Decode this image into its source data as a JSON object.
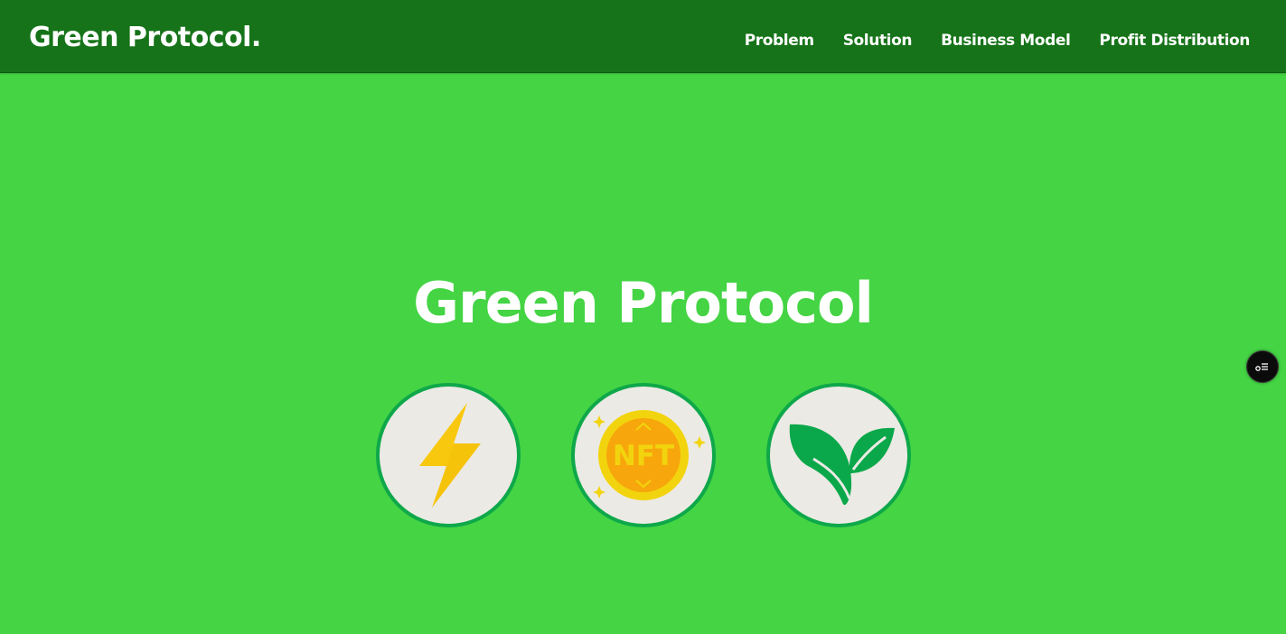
{
  "header": {
    "brand": "Green Protocol.",
    "nav": [
      {
        "label": "Problem"
      },
      {
        "label": "Solution"
      },
      {
        "label": "Business Model"
      },
      {
        "label": "Profit Distribution"
      }
    ]
  },
  "hero": {
    "title": "Green Protocol",
    "icons": [
      {
        "name": "lightning-icon"
      },
      {
        "name": "nft-coin-icon",
        "text": "NFT"
      },
      {
        "name": "leaf-icon"
      }
    ]
  },
  "floating_button": {
    "icon": "options-toggle-icon"
  },
  "colors": {
    "background": "#44d444",
    "navbar": "#167319",
    "circle_border": "#0ea84a",
    "circle_fill": "#eceae5",
    "lightning": "#f8c80e",
    "coin_outer": "#f2d40e",
    "coin_inner": "#f7a70c",
    "leaf": "#0aa84a"
  }
}
